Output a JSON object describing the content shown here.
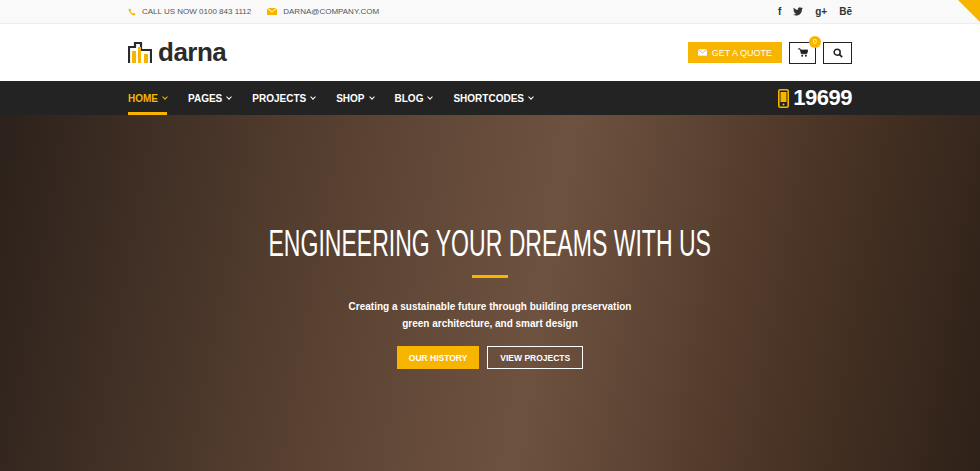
{
  "topbar": {
    "phone": "CALL US NOW 0100 843 1112",
    "email": "DARNA@COMPANY.COM",
    "social": [
      {
        "kind": "glyph",
        "label": "f"
      },
      {
        "kind": "twitter"
      },
      {
        "kind": "glyph",
        "label": "g+"
      },
      {
        "kind": "glyph",
        "label": "Bē"
      }
    ]
  },
  "header": {
    "logo": "darna",
    "quote_button": "GET A QUOTE",
    "cart_count": "0"
  },
  "nav": {
    "items": [
      {
        "label": "HOME",
        "selected": true,
        "dropdown": true
      },
      {
        "label": "PAGES",
        "selected": false,
        "dropdown": true
      },
      {
        "label": "PROJECTS",
        "selected": false,
        "dropdown": true
      },
      {
        "label": "SHOP",
        "selected": false,
        "dropdown": true
      },
      {
        "label": "BLOG",
        "selected": false,
        "dropdown": true
      },
      {
        "label": "SHORTCODES",
        "selected": false,
        "dropdown": true
      }
    ],
    "phone": "19699"
  },
  "hero": {
    "title": "ENGINEERING YOUR DREAMS WITH US",
    "subtitle": [
      "Creating a sustainable future through building preservation",
      "green architecture, and smart design"
    ],
    "buttons": [
      {
        "label": "OUR HISTORY",
        "kind": "primary"
      },
      {
        "label": "VIEW PROJECTS",
        "kind": "outline"
      }
    ]
  }
}
